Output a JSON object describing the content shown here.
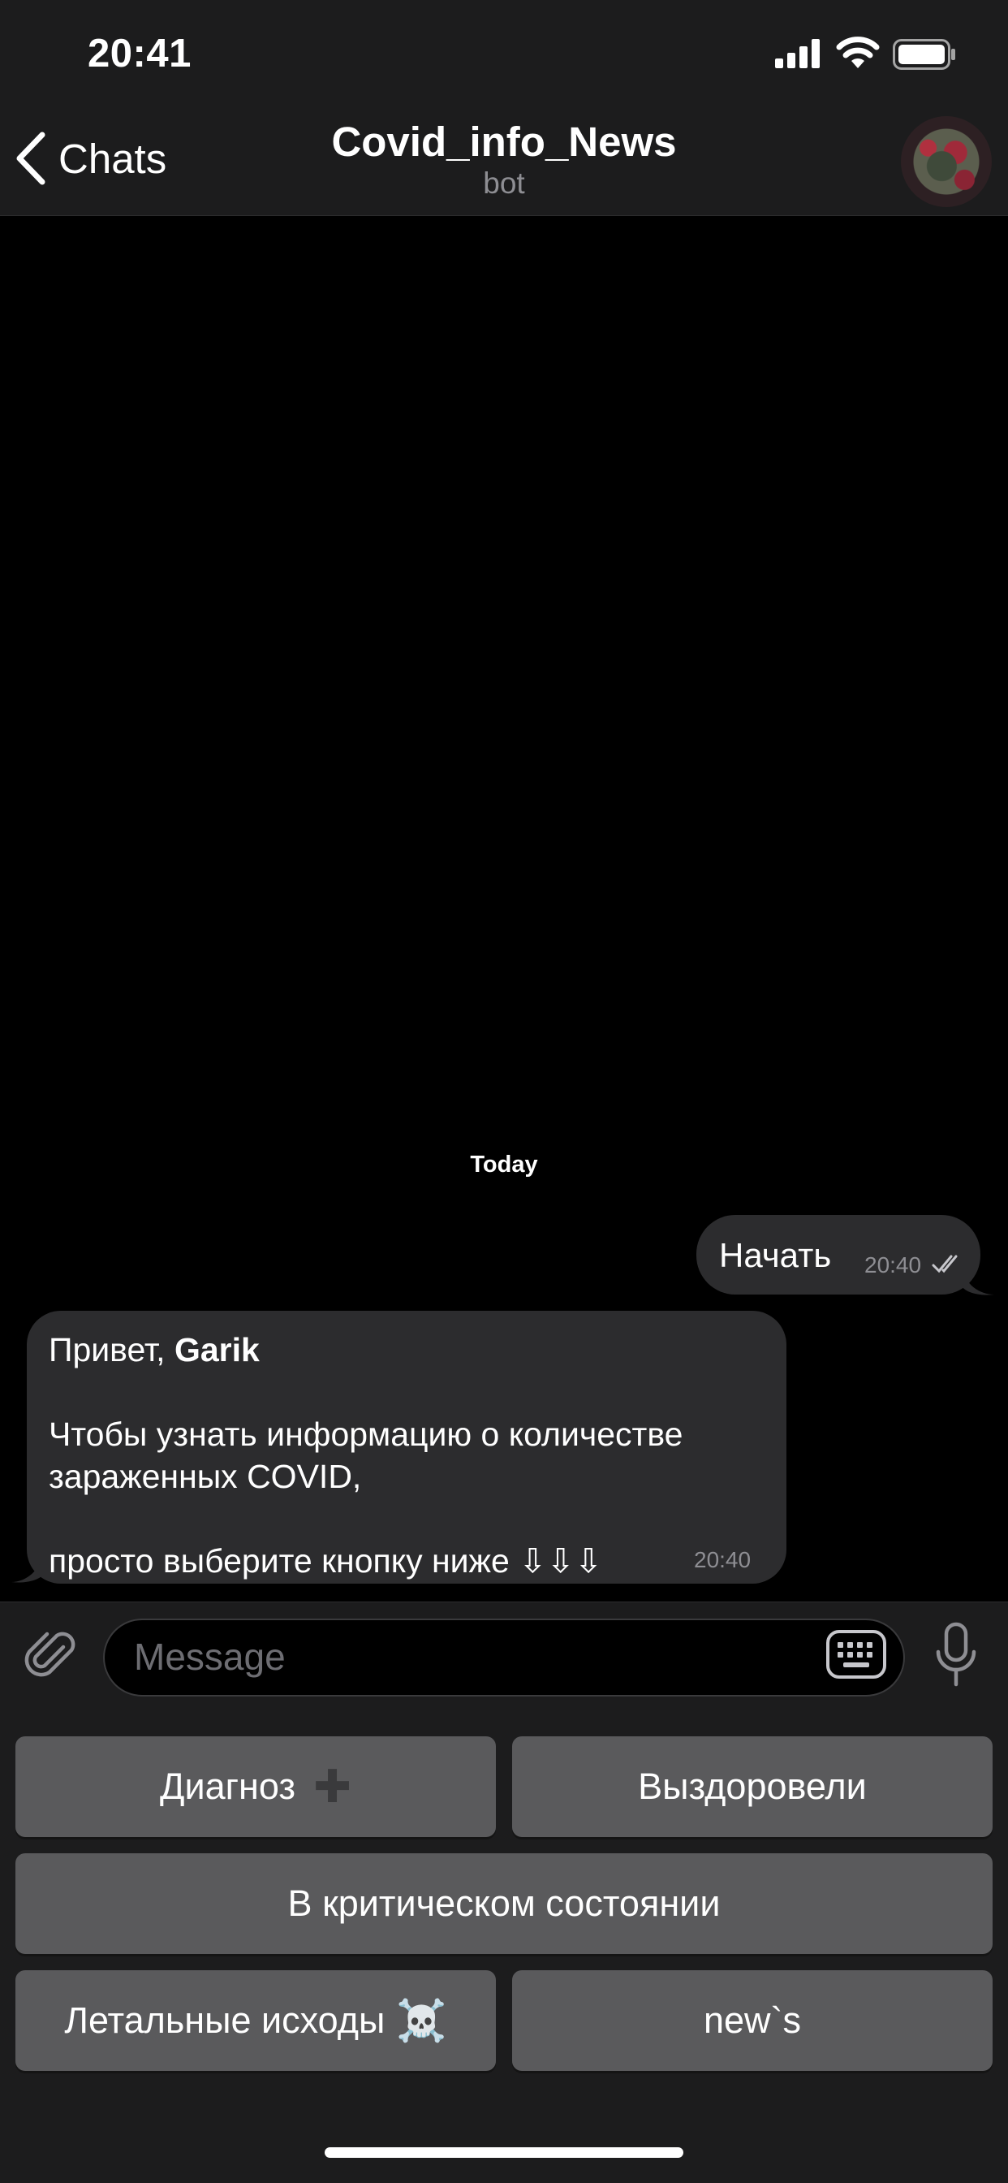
{
  "status_bar": {
    "time": "20:41"
  },
  "nav": {
    "back_label": "Chats",
    "title": "Covid_info_News",
    "subtitle": "bot"
  },
  "chat": {
    "date_label": "Today",
    "outgoing": {
      "text": "Начать",
      "time": "20:40",
      "status": "read"
    },
    "incoming": {
      "greeting": "Привет, ",
      "name": "Garik",
      "line2": "Чтобы узнать информацию о количестве",
      "line3": "зараженных COVID,",
      "line4": "просто выберите кнопку ниже ⇩⇩⇩",
      "time": "20:40"
    }
  },
  "input": {
    "placeholder": "Message"
  },
  "keyboard": {
    "diagnosis": "Диагноз",
    "diagnosis_suffix": "✚",
    "recovered": "Выздоровели",
    "critical": "В критическом состоянии",
    "deaths": "Летальные исходы",
    "deaths_suffix": "☠️",
    "news": "new`s"
  },
  "icons": {
    "back": "chevron-left-icon",
    "signal": "signal-icon",
    "wifi": "wifi-icon",
    "battery": "battery-icon",
    "attach": "paperclip-icon",
    "keyboard": "keyboard-icon",
    "mic": "microphone-icon"
  },
  "colors": {
    "bar_bg": "#1c1c1d",
    "bubble_bg": "#2c2c2e",
    "button_bg": "#5a5a5c",
    "secondary_text": "#8e8e93"
  }
}
